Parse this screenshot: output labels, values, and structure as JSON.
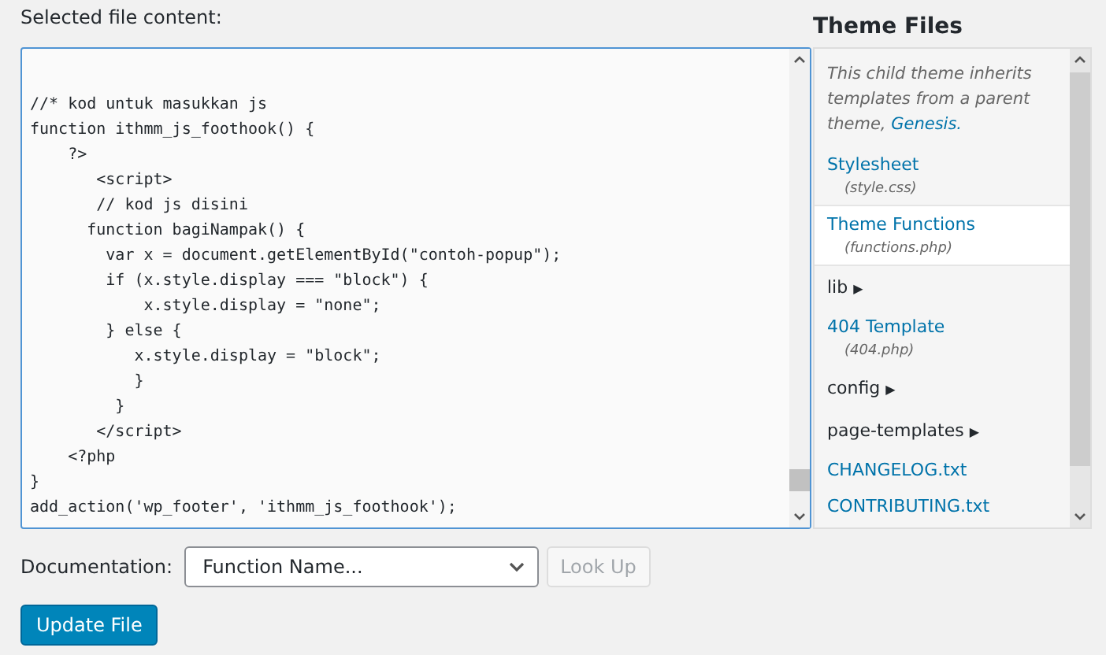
{
  "editor": {
    "label": "Selected file content:",
    "lines": [
      "//* kod untuk masukkan js",
      "function ithmm_js_foothook() {",
      "    ?>",
      "       <script>",
      "       // kod js disini",
      "      function bagiNampak() {",
      "        var x = document.getElementById(\"contoh-popup\");",
      "        if (x.style.display === \"block\") {",
      "            x.style.display = \"none\";",
      "        } else {",
      "           x.style.display = \"block\";",
      "           }",
      "         }",
      "       </script>",
      "    <?php",
      "}",
      "add_action('wp_footer', 'ithmm_js_foothook');"
    ]
  },
  "theme_files": {
    "title": "Theme Files",
    "items": [
      {
        "kind": "note",
        "text": "This child theme inherits templates from a parent theme,",
        "link": "Genesis."
      },
      {
        "kind": "file",
        "name": "Stylesheet",
        "file": "(style.css)",
        "selected": false
      },
      {
        "kind": "file",
        "name": "Theme Functions",
        "file": "(functions.php)",
        "selected": true
      },
      {
        "kind": "folder",
        "name": "lib",
        "arrow": "▶"
      },
      {
        "kind": "file",
        "name": "404 Template",
        "file": "(404.php)",
        "selected": false
      },
      {
        "kind": "folder",
        "name": "config",
        "arrow": "▶"
      },
      {
        "kind": "folder",
        "name": "page-templates",
        "arrow": "▶"
      },
      {
        "kind": "file",
        "name": "CHANGELOG.txt",
        "selected": false
      },
      {
        "kind": "file",
        "name": "CONTRIBUTING.txt",
        "selected": false
      }
    ]
  },
  "documentation": {
    "label": "Documentation:",
    "select": "Function Name...",
    "button": "Look Up",
    "disabled": true
  },
  "update_button": "Update File"
}
